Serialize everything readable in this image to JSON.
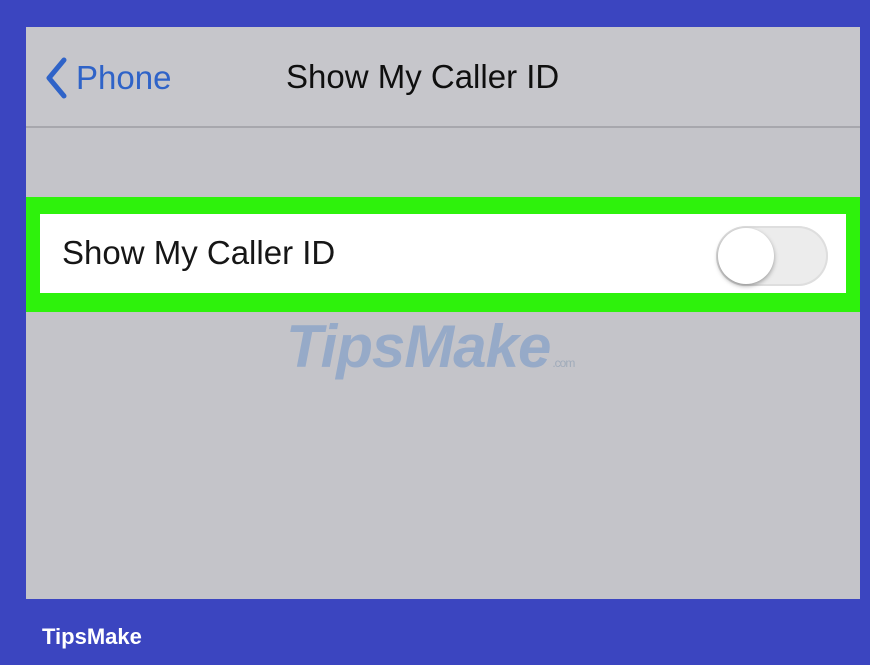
{
  "navbar": {
    "back_label": "Phone",
    "title": "Show My Caller ID"
  },
  "settings_row": {
    "label": "Show My Caller ID",
    "toggle_on": false
  },
  "watermark": {
    "main": "TipsMake",
    "suffix": ".com"
  },
  "footer": {
    "brand": "TipsMake"
  },
  "colors": {
    "frame": "#3b45c0",
    "highlight": "#2ef20c",
    "link": "#2f63c8",
    "screen_bg": "#c4c4c9"
  },
  "icons": {
    "back": "chevron-left-icon"
  }
}
